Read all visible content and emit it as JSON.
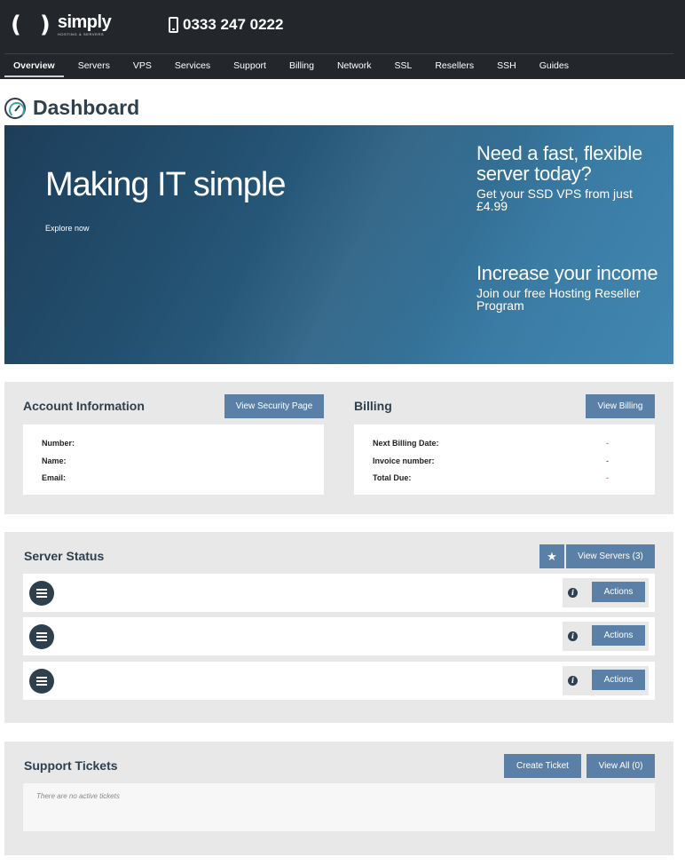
{
  "header": {
    "logo_brackets": "( )",
    "logo_word": "simply",
    "logo_tagline": "HOSTING & SERVERS",
    "phone": "0333 247 0222"
  },
  "nav": {
    "items": [
      "Overview",
      "Servers",
      "VPS",
      "Services",
      "Support",
      "Billing",
      "Network",
      "SSL",
      "Resellers",
      "SSH",
      "Guides"
    ],
    "active": "Overview"
  },
  "page": {
    "title": "Dashboard"
  },
  "hero": {
    "title": "Making IT simple",
    "link": "Explore now",
    "promo1": {
      "heading": "Need a fast, flexible server today?",
      "text": "Get your SSD VPS from just £4.99"
    },
    "promo2": {
      "heading": "Increase your income",
      "text": "Join our free Hosting Reseller Program"
    }
  },
  "account": {
    "title": "Account Information",
    "button": "View Security Page",
    "fields": [
      {
        "label": "Number:",
        "value": ""
      },
      {
        "label": "Name:",
        "value": ""
      },
      {
        "label": "Email:",
        "value": ""
      }
    ]
  },
  "billing": {
    "title": "Billing",
    "button": "View Billing",
    "fields": [
      {
        "label": "Next Billing Date:",
        "value": "-"
      },
      {
        "label": "Invoice number:",
        "value": "-"
      },
      {
        "label": "Total Due:",
        "value": "-"
      }
    ]
  },
  "servers": {
    "title": "Server Status",
    "star": "★",
    "button": "View Servers (3)",
    "rows": [
      {
        "info": "i",
        "action": "Actions"
      },
      {
        "info": "i",
        "action": "Actions"
      },
      {
        "info": "i",
        "action": "Actions"
      }
    ]
  },
  "tickets": {
    "title": "Support Tickets",
    "create_button": "Create Ticket",
    "view_button": "View All (0)",
    "empty_text": "There are no active tickets"
  },
  "colors": {
    "header_bg": "#23272b",
    "accent_button": "#5b80a7",
    "title_text": "#2e3f4d",
    "panel_bg": "#e8e8e8",
    "billing_value": "#c0392b"
  }
}
